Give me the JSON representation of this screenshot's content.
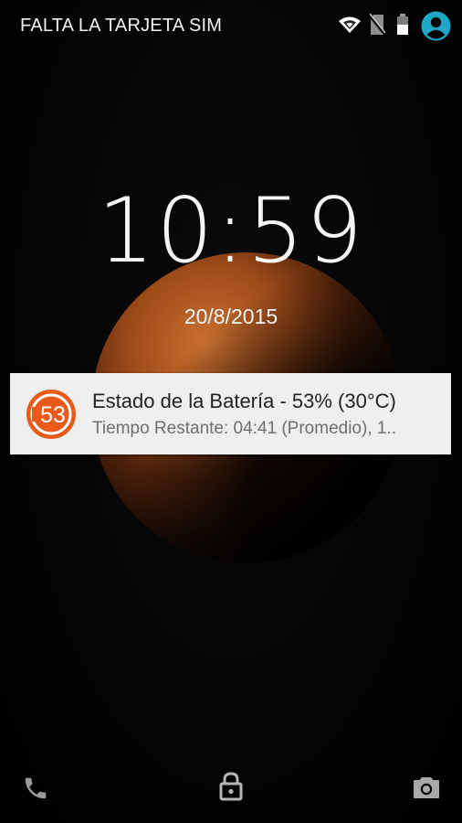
{
  "status_bar": {
    "carrier_text": "FALTA LA TARJETA SIM",
    "icons": [
      "wifi-icon",
      "no-sim-icon",
      "battery-icon",
      "account-avatar-icon"
    ],
    "accent_color": "#1ea7c7"
  },
  "lockscreen": {
    "time": "10:59",
    "date": "20/8/2015"
  },
  "notification": {
    "icon_text": "53",
    "icon_color": "#e8591a",
    "title": "Estado de la Batería - 53% (30°C)",
    "text": "Tiempo Restante: 04:41 (Promedio), 1.."
  },
  "bottom_bar": {
    "icons": [
      "phone-icon",
      "lock-icon",
      "camera-icon"
    ]
  }
}
